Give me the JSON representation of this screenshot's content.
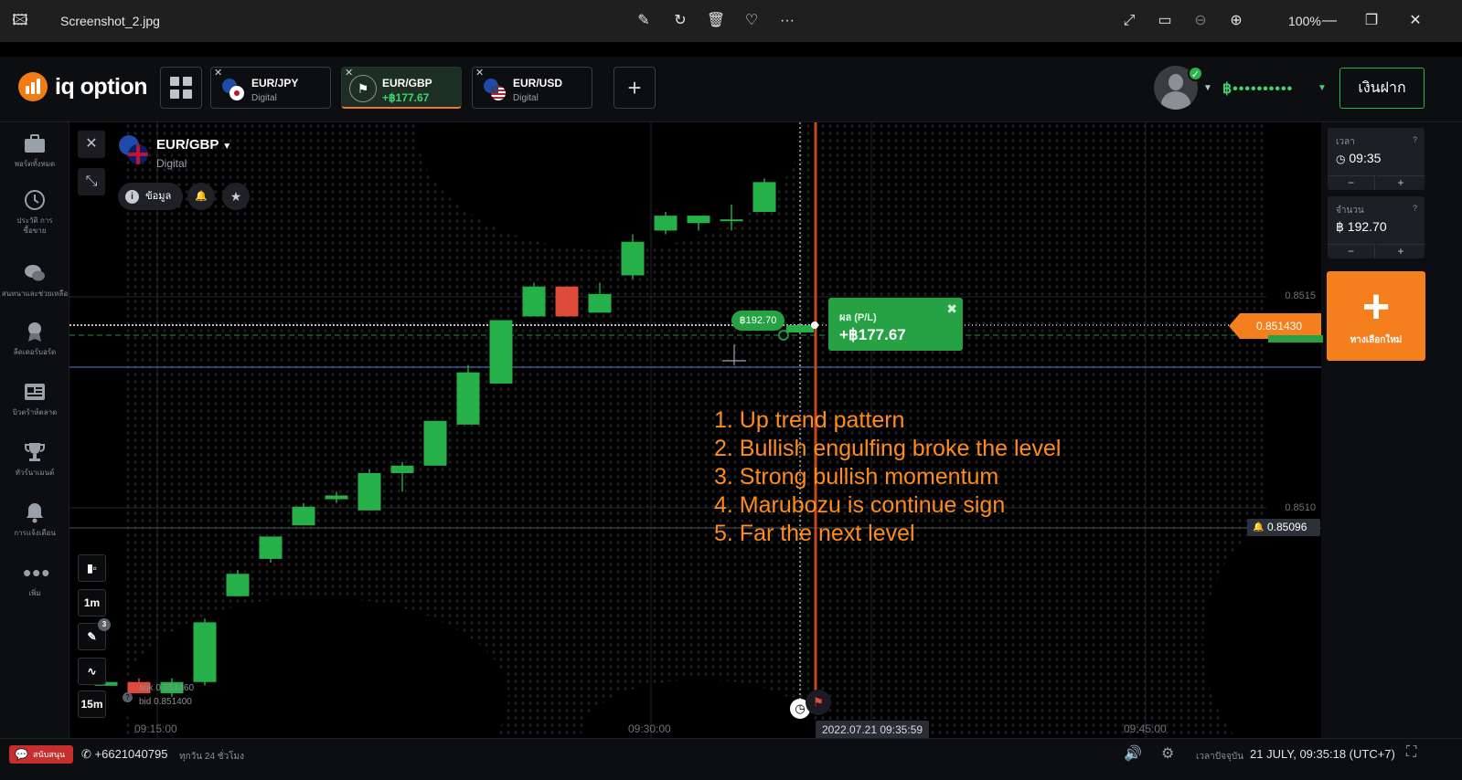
{
  "viewer": {
    "title": "Screenshot_2.jpg",
    "zoom": "100%"
  },
  "app": {
    "logo_text": "iq option",
    "tabs": [
      {
        "pair": "EUR/JPY",
        "sub": "Digital",
        "active": false
      },
      {
        "pair": "EUR/GBP",
        "sub": "+฿177.67",
        "active": true
      },
      {
        "pair": "EUR/USD",
        "sub": "Digital",
        "active": false
      }
    ],
    "balance": "฿••••••••••",
    "deposit_label": "เงินฝาก"
  },
  "sidebar": {
    "items": [
      {
        "label": "พอร์ตทั้งหมด",
        "icon": "briefcase-icon"
      },
      {
        "label": "ประวัติ การซื้อขาย",
        "icon": "history-icon"
      },
      {
        "label": "สนทนาและช่วยเหลือ",
        "icon": "chat-icon"
      },
      {
        "label": "ลีดเดอร์บอร์ด",
        "icon": "award-icon"
      },
      {
        "label": "บิวตร้าห์ตลาด",
        "icon": "news-icon"
      },
      {
        "label": "ทัวร์นาเมนต์",
        "icon": "trophy-icon"
      },
      {
        "label": "การแจ้งเตือน",
        "icon": "bell-icon"
      },
      {
        "label": "เพิ่ม",
        "icon": "more-icon"
      }
    ]
  },
  "asset": {
    "name": "EUR/GBP",
    "type": "Digital",
    "info_label": "ข้อมูล"
  },
  "chart": {
    "price_levels": [
      "0.8515",
      "0.8510"
    ],
    "time_labels": [
      "09:15:00",
      "09:30:00",
      "09:45:00"
    ],
    "current_price": "0.851430",
    "alert_price": "0.85096",
    "expiry": "2022.07.21 09:35:59",
    "ask": "ask 0.851460",
    "bid": "bid 0.851400",
    "timeframe_1": "1m",
    "timeframe_2": "15m",
    "drawing_count": "3",
    "position_amount": "฿192.70",
    "pl_title": "ผล (P/L)",
    "pl_value": "+฿177.67",
    "annotations": [
      "1. Up trend pattern",
      "2. Bullish engulfing broke the level",
      "3. Strong bullish momentum",
      "4. Marubozu is continue sign",
      "5. Far the next level"
    ]
  },
  "chart_data": {
    "type": "candlestick",
    "candles": [
      {
        "o": 0.85047,
        "c": 0.85048,
        "h": 0.85048,
        "l": 0.85047
      },
      {
        "o": 0.85048,
        "c": 0.85045,
        "h": 0.85049,
        "l": 0.85045
      },
      {
        "o": 0.85045,
        "c": 0.85048,
        "h": 0.85049,
        "l": 0.85044
      },
      {
        "o": 0.85048,
        "c": 0.85064,
        "h": 0.85065,
        "l": 0.85047
      },
      {
        "o": 0.85071,
        "c": 0.85077,
        "h": 0.85078,
        "l": 0.85071
      },
      {
        "o": 0.85081,
        "c": 0.85087,
        "h": 0.85087,
        "l": 0.8508
      },
      {
        "o": 0.8509,
        "c": 0.85095,
        "h": 0.85096,
        "l": 0.8509
      },
      {
        "o": 0.85097,
        "c": 0.85098,
        "h": 0.85099,
        "l": 0.85096
      },
      {
        "o": 0.85094,
        "c": 0.85104,
        "h": 0.85105,
        "l": 0.85094
      },
      {
        "o": 0.85104,
        "c": 0.85106,
        "h": 0.85107,
        "l": 0.85099
      },
      {
        "o": 0.85106,
        "c": 0.85118,
        "h": 0.85118,
        "l": 0.85106
      },
      {
        "o": 0.85117,
        "c": 0.85131,
        "h": 0.85133,
        "l": 0.85117
      },
      {
        "o": 0.85128,
        "c": 0.85145,
        "h": 0.85145,
        "l": 0.85128
      },
      {
        "o": 0.85146,
        "c": 0.85154,
        "h": 0.85155,
        "l": 0.85146
      },
      {
        "o": 0.85154,
        "c": 0.85146,
        "h": 0.85154,
        "l": 0.85146
      },
      {
        "o": 0.85147,
        "c": 0.85152,
        "h": 0.85155,
        "l": 0.85147
      },
      {
        "o": 0.85157,
        "c": 0.85166,
        "h": 0.85168,
        "l": 0.85156
      },
      {
        "o": 0.85169,
        "c": 0.85173,
        "h": 0.85174,
        "l": 0.85168
      },
      {
        "o": 0.85171,
        "c": 0.85173,
        "h": 0.85173,
        "l": 0.85169
      },
      {
        "o": 0.85172,
        "c": 0.85172,
        "h": 0.85176,
        "l": 0.85169
      },
      {
        "o": 0.85174,
        "c": 0.85182,
        "h": 0.85183,
        "l": 0.85174
      }
    ],
    "ylim": [
      0.85033,
      0.85198
    ],
    "y_ticks": [
      "0.8515",
      "0.8510"
    ],
    "x_ticks": [
      "09:15:00",
      "09:30:00",
      "09:45:00"
    ]
  },
  "right_panel": {
    "time_label": "เวลา",
    "time_value": "09:35",
    "amount_label": "จำนวน",
    "amount_value": "฿  192.70",
    "new_option_label": "ทางเลือกใหม่"
  },
  "bottom": {
    "support": "สนับสนุน",
    "phone": "+6621040795",
    "hours": "ทุกวัน 24 ชั่วโมง",
    "current_time_label": "เวลาปัจจุบัน",
    "current_time": "21 JULY, 09:35:18 (UTC+7)"
  },
  "colors": {
    "bull": "#26b04a",
    "bear": "#e04a38",
    "accent": "#f57e1d",
    "annotation": "#ff8c1a"
  }
}
